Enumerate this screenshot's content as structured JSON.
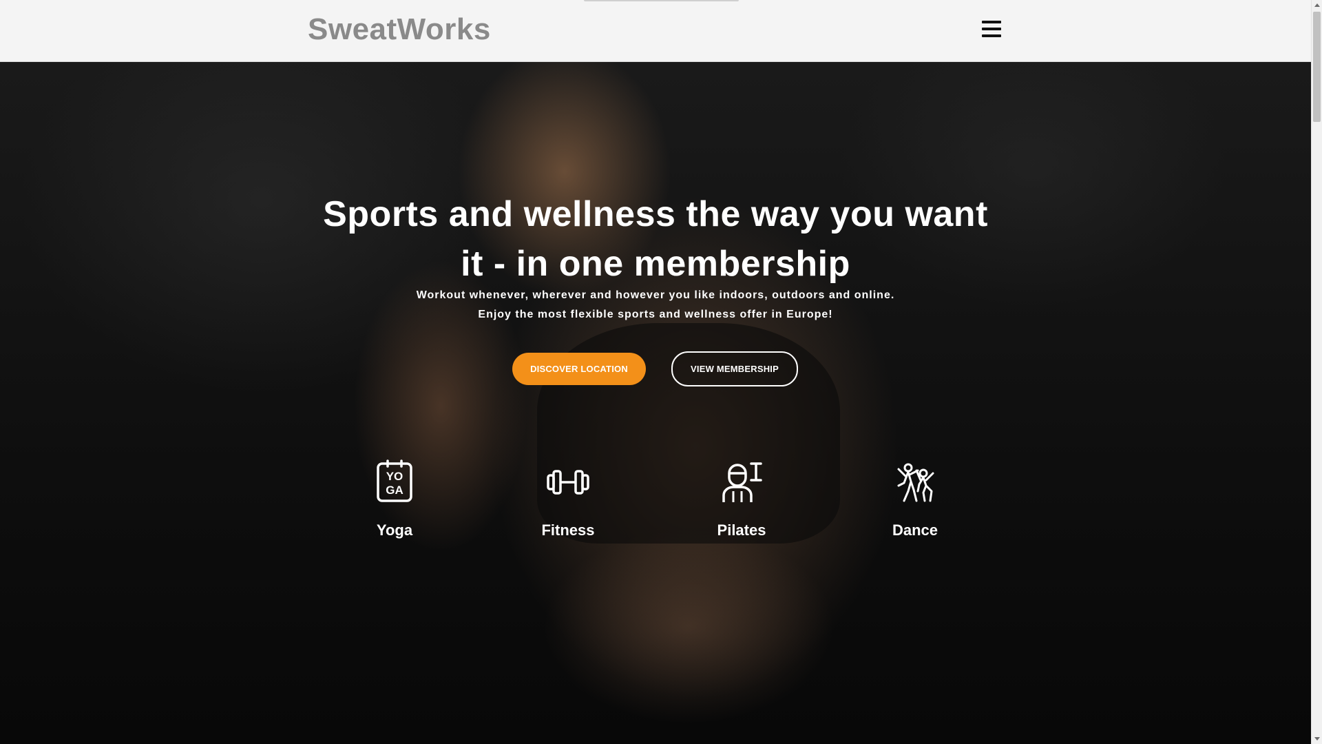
{
  "header": {
    "brand": "SweatWorks",
    "menu_icon": "hamburger-menu-icon"
  },
  "hero": {
    "headline": "Sports and wellness the way you want it - in one membership",
    "subtext": "Workout whenever, wherever and however you like indoors, outdoors and online. Enjoy the most flexible sports and wellness offer in Europe!",
    "primary_button": "DISCOVER LOCATION",
    "secondary_button": "VIEW MEMBERSHIP"
  },
  "categories": [
    {
      "label": "Yoga",
      "icon": "yoga-icon"
    },
    {
      "label": "Fitness",
      "icon": "dumbbell-icon"
    },
    {
      "label": "Pilates",
      "icon": "pilates-instructor-icon"
    },
    {
      "label": "Dance",
      "icon": "dancers-icon"
    }
  ],
  "colors": {
    "accent": "#f39019",
    "header_bg": "#f4f4f4",
    "brand_text": "#8a8a8a",
    "hero_text": "#ffffff"
  }
}
